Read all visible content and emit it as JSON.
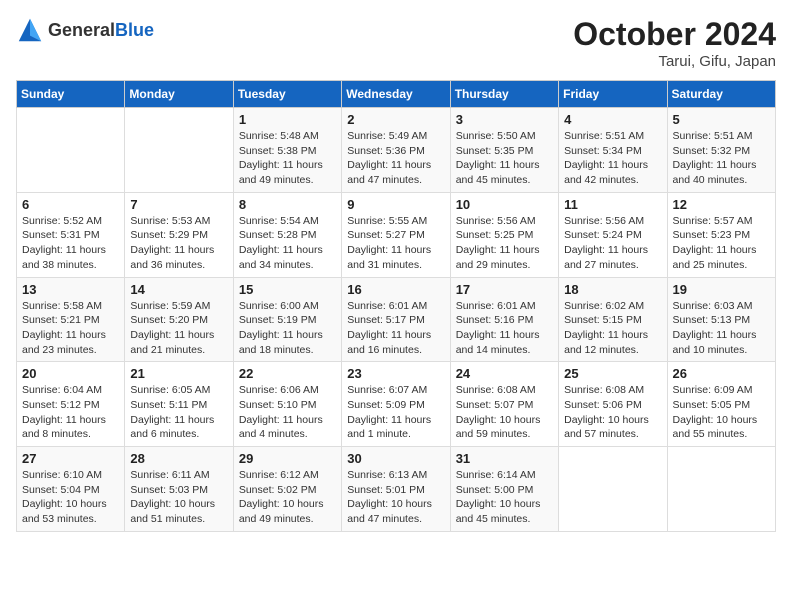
{
  "header": {
    "logo_general": "General",
    "logo_blue": "Blue",
    "month": "October 2024",
    "location": "Tarui, Gifu, Japan"
  },
  "days_of_week": [
    "Sunday",
    "Monday",
    "Tuesday",
    "Wednesday",
    "Thursday",
    "Friday",
    "Saturday"
  ],
  "weeks": [
    [
      {
        "day": "",
        "info": ""
      },
      {
        "day": "",
        "info": ""
      },
      {
        "day": "1",
        "info": "Sunrise: 5:48 AM\nSunset: 5:38 PM\nDaylight: 11 hours and 49 minutes."
      },
      {
        "day": "2",
        "info": "Sunrise: 5:49 AM\nSunset: 5:36 PM\nDaylight: 11 hours and 47 minutes."
      },
      {
        "day": "3",
        "info": "Sunrise: 5:50 AM\nSunset: 5:35 PM\nDaylight: 11 hours and 45 minutes."
      },
      {
        "day": "4",
        "info": "Sunrise: 5:51 AM\nSunset: 5:34 PM\nDaylight: 11 hours and 42 minutes."
      },
      {
        "day": "5",
        "info": "Sunrise: 5:51 AM\nSunset: 5:32 PM\nDaylight: 11 hours and 40 minutes."
      }
    ],
    [
      {
        "day": "6",
        "info": "Sunrise: 5:52 AM\nSunset: 5:31 PM\nDaylight: 11 hours and 38 minutes."
      },
      {
        "day": "7",
        "info": "Sunrise: 5:53 AM\nSunset: 5:29 PM\nDaylight: 11 hours and 36 minutes."
      },
      {
        "day": "8",
        "info": "Sunrise: 5:54 AM\nSunset: 5:28 PM\nDaylight: 11 hours and 34 minutes."
      },
      {
        "day": "9",
        "info": "Sunrise: 5:55 AM\nSunset: 5:27 PM\nDaylight: 11 hours and 31 minutes."
      },
      {
        "day": "10",
        "info": "Sunrise: 5:56 AM\nSunset: 5:25 PM\nDaylight: 11 hours and 29 minutes."
      },
      {
        "day": "11",
        "info": "Sunrise: 5:56 AM\nSunset: 5:24 PM\nDaylight: 11 hours and 27 minutes."
      },
      {
        "day": "12",
        "info": "Sunrise: 5:57 AM\nSunset: 5:23 PM\nDaylight: 11 hours and 25 minutes."
      }
    ],
    [
      {
        "day": "13",
        "info": "Sunrise: 5:58 AM\nSunset: 5:21 PM\nDaylight: 11 hours and 23 minutes."
      },
      {
        "day": "14",
        "info": "Sunrise: 5:59 AM\nSunset: 5:20 PM\nDaylight: 11 hours and 21 minutes."
      },
      {
        "day": "15",
        "info": "Sunrise: 6:00 AM\nSunset: 5:19 PM\nDaylight: 11 hours and 18 minutes."
      },
      {
        "day": "16",
        "info": "Sunrise: 6:01 AM\nSunset: 5:17 PM\nDaylight: 11 hours and 16 minutes."
      },
      {
        "day": "17",
        "info": "Sunrise: 6:01 AM\nSunset: 5:16 PM\nDaylight: 11 hours and 14 minutes."
      },
      {
        "day": "18",
        "info": "Sunrise: 6:02 AM\nSunset: 5:15 PM\nDaylight: 11 hours and 12 minutes."
      },
      {
        "day": "19",
        "info": "Sunrise: 6:03 AM\nSunset: 5:13 PM\nDaylight: 11 hours and 10 minutes."
      }
    ],
    [
      {
        "day": "20",
        "info": "Sunrise: 6:04 AM\nSunset: 5:12 PM\nDaylight: 11 hours and 8 minutes."
      },
      {
        "day": "21",
        "info": "Sunrise: 6:05 AM\nSunset: 5:11 PM\nDaylight: 11 hours and 6 minutes."
      },
      {
        "day": "22",
        "info": "Sunrise: 6:06 AM\nSunset: 5:10 PM\nDaylight: 11 hours and 4 minutes."
      },
      {
        "day": "23",
        "info": "Sunrise: 6:07 AM\nSunset: 5:09 PM\nDaylight: 11 hours and 1 minute."
      },
      {
        "day": "24",
        "info": "Sunrise: 6:08 AM\nSunset: 5:07 PM\nDaylight: 10 hours and 59 minutes."
      },
      {
        "day": "25",
        "info": "Sunrise: 6:08 AM\nSunset: 5:06 PM\nDaylight: 10 hours and 57 minutes."
      },
      {
        "day": "26",
        "info": "Sunrise: 6:09 AM\nSunset: 5:05 PM\nDaylight: 10 hours and 55 minutes."
      }
    ],
    [
      {
        "day": "27",
        "info": "Sunrise: 6:10 AM\nSunset: 5:04 PM\nDaylight: 10 hours and 53 minutes."
      },
      {
        "day": "28",
        "info": "Sunrise: 6:11 AM\nSunset: 5:03 PM\nDaylight: 10 hours and 51 minutes."
      },
      {
        "day": "29",
        "info": "Sunrise: 6:12 AM\nSunset: 5:02 PM\nDaylight: 10 hours and 49 minutes."
      },
      {
        "day": "30",
        "info": "Sunrise: 6:13 AM\nSunset: 5:01 PM\nDaylight: 10 hours and 47 minutes."
      },
      {
        "day": "31",
        "info": "Sunrise: 6:14 AM\nSunset: 5:00 PM\nDaylight: 10 hours and 45 minutes."
      },
      {
        "day": "",
        "info": ""
      },
      {
        "day": "",
        "info": ""
      }
    ]
  ]
}
